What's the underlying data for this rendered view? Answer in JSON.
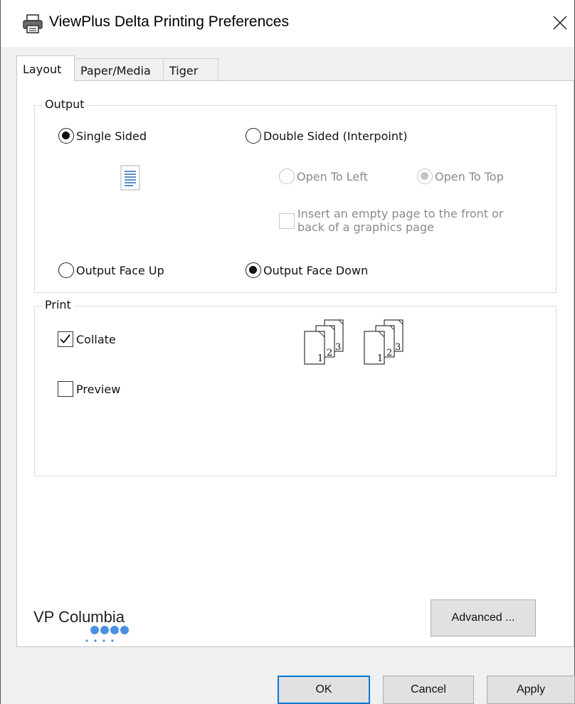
{
  "window": {
    "title": "ViewPlus Delta Printing Preferences",
    "title_icon": "printer-icon",
    "close_icon": "close-icon"
  },
  "tabs": [
    {
      "label": "Layout",
      "active": true
    },
    {
      "label": "Paper/Media",
      "active": false
    },
    {
      "label": "Tiger",
      "active": false
    }
  ],
  "output": {
    "group_label": "Output",
    "single_sided": {
      "label": "Single Sided",
      "checked": true
    },
    "double_sided": {
      "label": "Double Sided (Interpoint)",
      "checked": false
    },
    "open_to_left": {
      "label": "Open To Left",
      "checked": false,
      "disabled": true
    },
    "open_to_top": {
      "label": "Open To Top",
      "checked": true,
      "disabled": true
    },
    "insert_empty_page": {
      "label_line1": "Insert an empty page to the front or",
      "label_line2": "back of a graphics page",
      "checked": false,
      "disabled": true
    },
    "face_up": {
      "label": "Output Face Up",
      "checked": false
    },
    "face_down": {
      "label": "Output Face Down",
      "checked": true
    }
  },
  "print": {
    "group_label": "Print",
    "collate": {
      "label": "Collate",
      "checked": true
    },
    "preview": {
      "label": "Preview",
      "checked": false
    },
    "collate_pages": [
      "1",
      "2",
      "3"
    ]
  },
  "logo": {
    "text": "VP Columbia"
  },
  "buttons": {
    "advanced": "Advanced ...",
    "ok": "OK",
    "cancel": "Cancel",
    "apply": "Apply"
  },
  "colors": {
    "accent": "#0078d7",
    "logo_dots": "#4a90e2"
  }
}
